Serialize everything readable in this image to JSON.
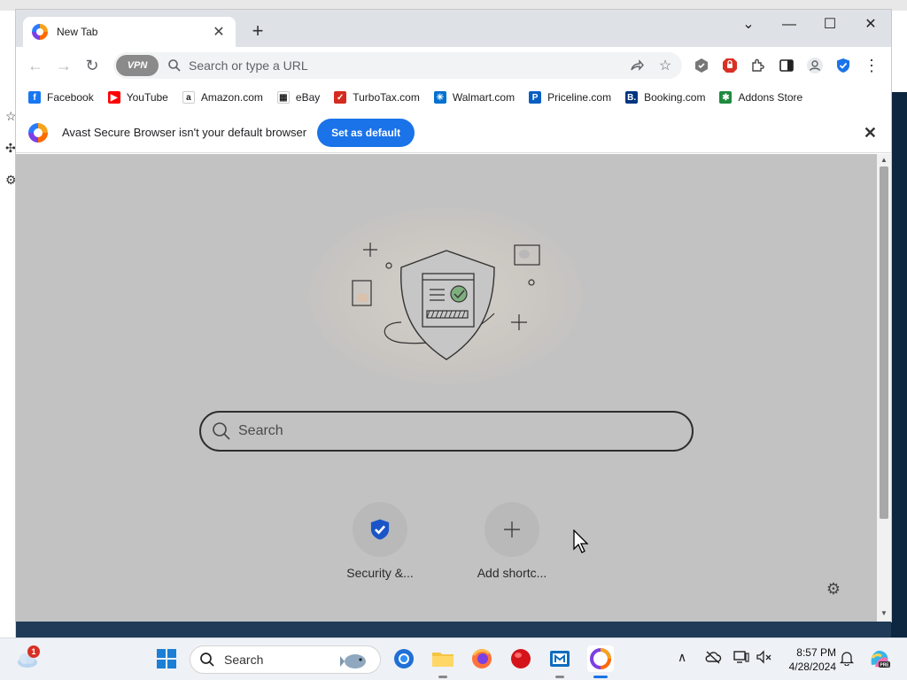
{
  "window": {
    "tab_title": "New Tab",
    "new_tab_label": "+",
    "close_tab_label": "✕",
    "controls": {
      "tab_search": "⌄",
      "minimize": "—",
      "maximize": "☐",
      "close": "✕"
    }
  },
  "toolbar": {
    "back_icon": "←",
    "forward_icon": "→",
    "reload_icon": "↻",
    "vpn_label": "VPN",
    "omnibox_placeholder": "Search or type a URL",
    "menu_icon": "⋮"
  },
  "bookmarks": [
    {
      "label": "Facebook",
      "icon": "facebook-icon",
      "color": "#1877f2",
      "glyph": "f"
    },
    {
      "label": "YouTube",
      "icon": "youtube-icon",
      "color": "#ff0000",
      "glyph": "▶"
    },
    {
      "label": "Amazon.com",
      "icon": "amazon-icon",
      "color": "#ffffff",
      "glyph": "a"
    },
    {
      "label": "eBay",
      "icon": "ebay-icon",
      "color": "#ffffff",
      "glyph": "▦"
    },
    {
      "label": "TurboTax.com",
      "icon": "turbotax-icon",
      "color": "#d52b1e",
      "glyph": "✓"
    },
    {
      "label": "Walmart.com",
      "icon": "walmart-icon",
      "color": "#0071ce",
      "glyph": "✳"
    },
    {
      "label": "Priceline.com",
      "icon": "priceline-icon",
      "color": "#0a5ec2",
      "glyph": "P"
    },
    {
      "label": "Booking.com",
      "icon": "booking-icon",
      "color": "#003580",
      "glyph": "B."
    },
    {
      "label": "Addons Store",
      "icon": "addons-store-icon",
      "color": "#1e8a3e",
      "glyph": "✱"
    }
  ],
  "infobar": {
    "message": "Avast Secure Browser isn't your default browser",
    "button_label": "Set as default",
    "close_label": "✕"
  },
  "newtab": {
    "search_placeholder": "Search",
    "shortcuts": [
      {
        "label": "Security &..."
      },
      {
        "label": "Add shortc..."
      }
    ],
    "settings_icon": "⚙"
  },
  "taskbar": {
    "weather_badge": "1",
    "search_label": "Search",
    "time": "8:57 PM",
    "date": "4/28/2024",
    "tray_chevron": "∧",
    "colors": {
      "accent": "#1a73e8"
    }
  }
}
